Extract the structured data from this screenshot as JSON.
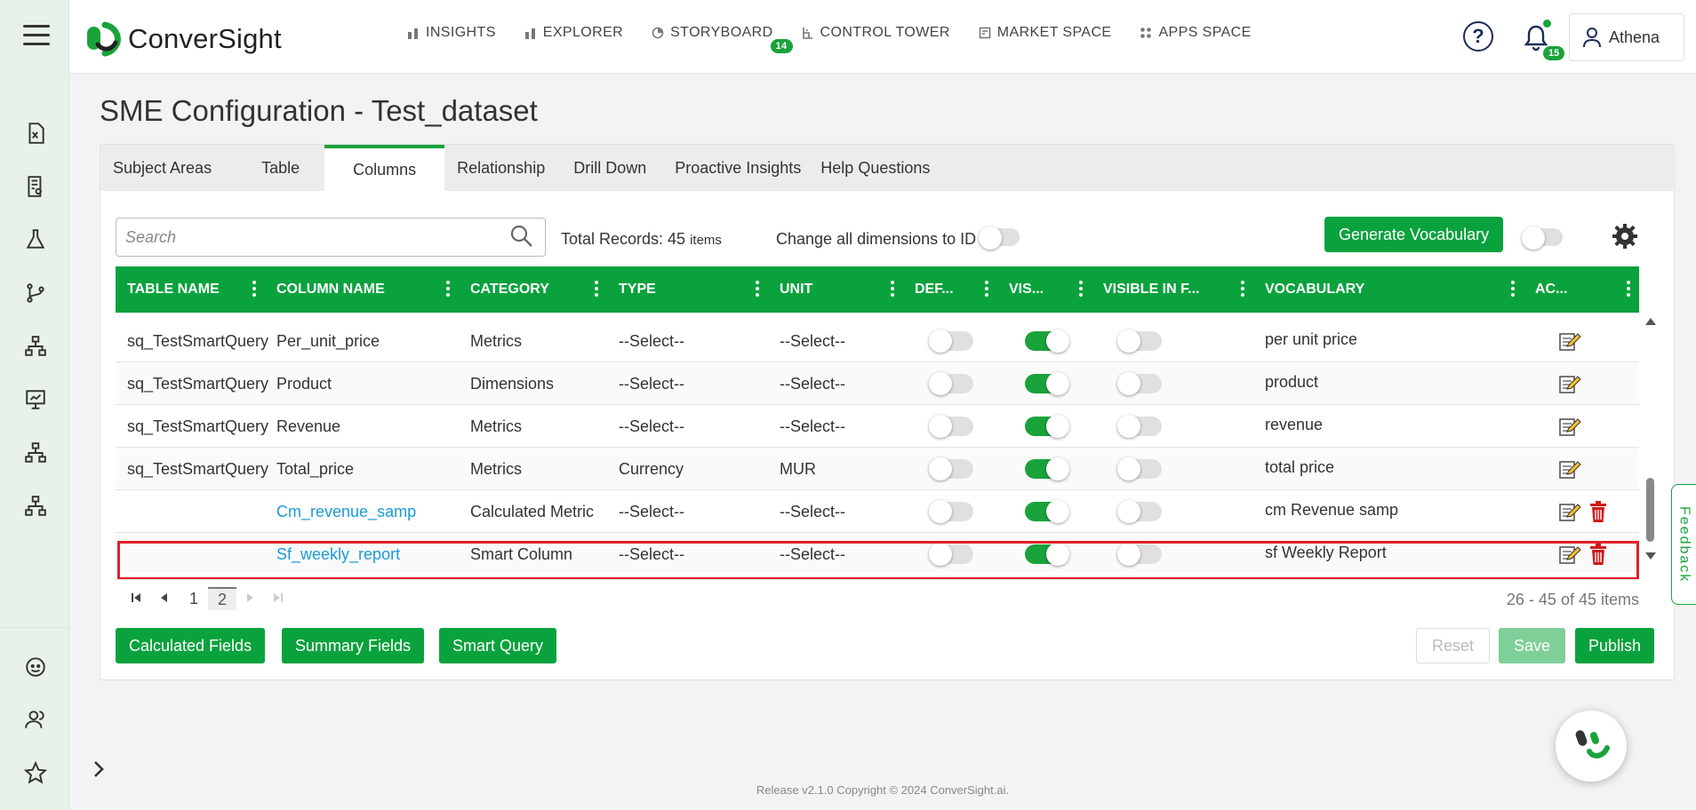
{
  "app": {
    "logo_text": "ConverSight"
  },
  "nav": {
    "items": [
      {
        "label": "INSIGHTS",
        "icon": "bar-chart-icon"
      },
      {
        "label": "EXPLORER",
        "icon": "bar-chart-icon"
      },
      {
        "label": "STORYBOARD",
        "icon": "pie-icon",
        "badge": "14"
      },
      {
        "label": "CONTROL TOWER",
        "icon": "tower-icon"
      },
      {
        "label": "MARKET SPACE",
        "icon": "store-icon"
      },
      {
        "label": "APPS SPACE",
        "icon": "apps-icon"
      }
    ],
    "notification_count": "15",
    "user_name": "Athena"
  },
  "page": {
    "title": "SME Configuration - Test_dataset"
  },
  "tabs": [
    "Subject Areas",
    "Table",
    "Columns",
    "Relationship",
    "Drill Down",
    "Proactive Insights",
    "Help Questions"
  ],
  "active_tab": "Columns",
  "toolbar": {
    "search_placeholder": "Search",
    "total_label": "Total Records: 45",
    "total_unit": "items",
    "dimensions_toggle_label": "Change all dimensions to ID",
    "generate_label": "Generate Vocabulary"
  },
  "grid": {
    "columns": [
      "TABLE NAME",
      "COLUMN NAME",
      "CATEGORY",
      "TYPE",
      "UNIT",
      "DEF...",
      "VIS...",
      "VISIBLE IN F...",
      "VOCABULARY",
      "AC..."
    ],
    "rows": [
      {
        "table": "sq_TestSmartQuery",
        "column": "Per_unit_price",
        "category": "Metrics",
        "type": "--Select--",
        "unit": "--Select--",
        "def": false,
        "vis": true,
        "visf": false,
        "vocab": "per unit price",
        "deletable": false,
        "link": false
      },
      {
        "table": "sq_TestSmartQuery",
        "column": "Product",
        "category": "Dimensions",
        "type": "--Select--",
        "unit": "--Select--",
        "def": false,
        "vis": true,
        "visf": false,
        "vocab": "product",
        "deletable": false,
        "link": false
      },
      {
        "table": "sq_TestSmartQuery",
        "column": "Revenue",
        "category": "Metrics",
        "type": "--Select--",
        "unit": "--Select--",
        "def": false,
        "vis": true,
        "visf": false,
        "vocab": "revenue",
        "deletable": false,
        "link": false
      },
      {
        "table": "sq_TestSmartQuery",
        "column": "Total_price",
        "category": "Metrics",
        "type": "Currency",
        "unit": "MUR",
        "def": false,
        "vis": true,
        "visf": false,
        "vocab": "total price",
        "deletable": false,
        "link": false
      },
      {
        "table": "",
        "column": "Cm_revenue_samp",
        "category": "Calculated Metric",
        "type": "--Select--",
        "unit": "--Select--",
        "def": false,
        "vis": true,
        "visf": false,
        "vocab": "cm Revenue samp",
        "deletable": true,
        "link": true
      },
      {
        "table": "",
        "column": "Sf_weekly_report",
        "category": "Smart Column",
        "type": "--Select--",
        "unit": "--Select--",
        "def": false,
        "vis": true,
        "visf": false,
        "vocab": "sf Weekly Report",
        "deletable": true,
        "link": true
      }
    ]
  },
  "pager": {
    "pages": [
      "1",
      "2"
    ],
    "current": "2",
    "info": "26 - 45 of 45 items"
  },
  "actions": {
    "calculated": "Calculated Fields",
    "summary": "Summary Fields",
    "smart_query": "Smart Query",
    "reset": "Reset",
    "save": "Save",
    "publish": "Publish"
  },
  "feedback_label": "Feedback",
  "footer": "Release v2.1.0 Copyright © 2024 ConverSight.ai.",
  "colors": {
    "brand_green": "#0aa23d",
    "link_blue": "#1a9bd6",
    "highlight_red": "#e0202a"
  }
}
